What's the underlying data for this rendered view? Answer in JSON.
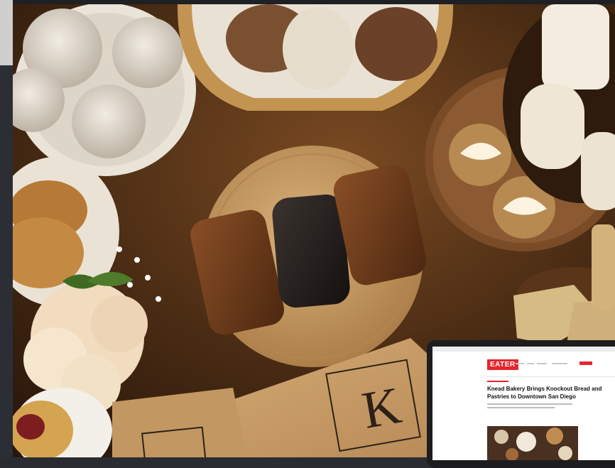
{
  "photo": {
    "subject": "bakery-spread",
    "box_brand_mark": "K"
  },
  "laptop": {
    "site_logo": "EATER",
    "headline": "Knead Bakery Brings Knockout Bread and Pastries to Downtown San Diego",
    "colors": {
      "brand_red": "#e6262e"
    }
  },
  "colors": {
    "table": "#3a2412",
    "cutting_board": "#c69a63",
    "kraft_box": "#c49863",
    "frame": "#2b2e35"
  }
}
